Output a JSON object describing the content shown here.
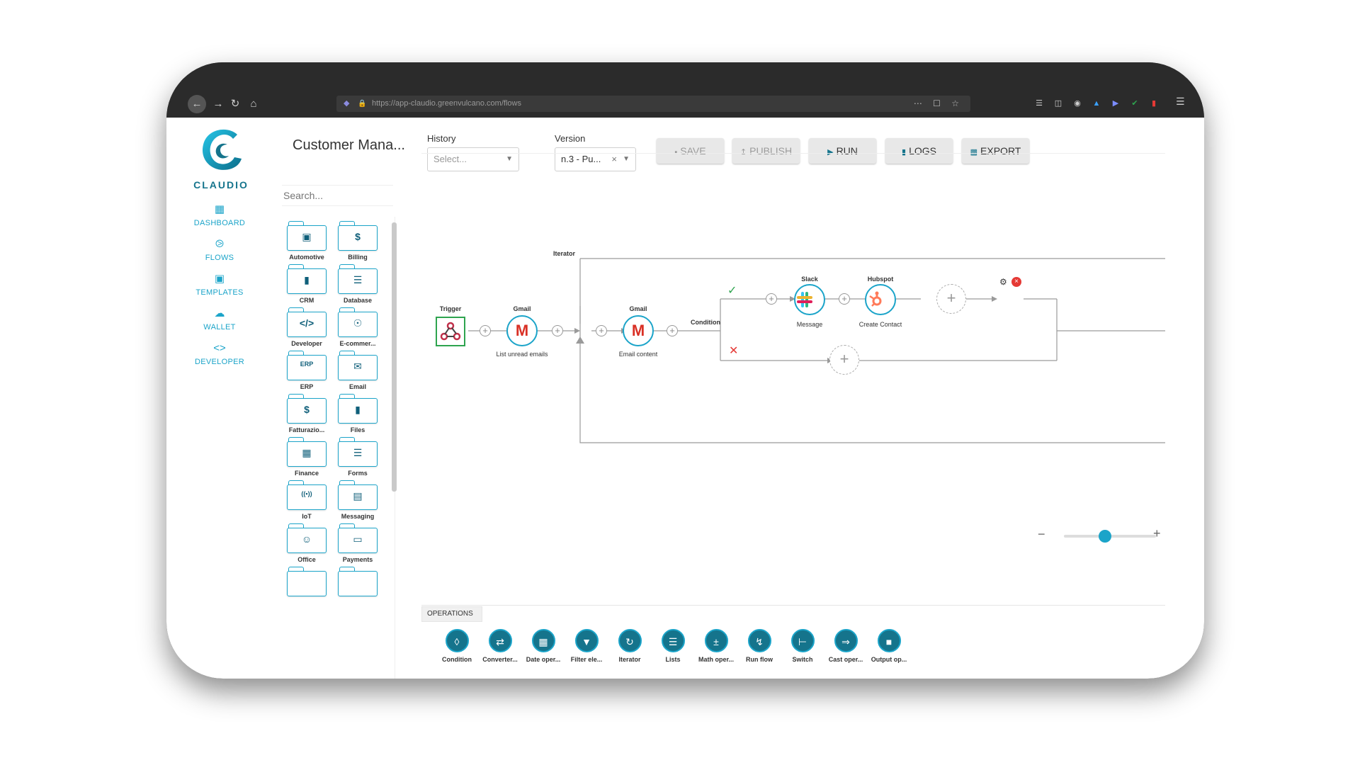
{
  "browser": {
    "url": "https://app-claudio.greenvulcano.com/flows",
    "nav": [
      "arrow-left-icon",
      "arrow-right-icon",
      "reload-icon",
      "home-icon"
    ]
  },
  "app": {
    "logo_text": "CLAUDIO",
    "nav": [
      {
        "label": "DASHBOARD",
        "icon": "dashboard-icon"
      },
      {
        "label": "FLOWS",
        "icon": "flows-icon"
      },
      {
        "label": "TEMPLATES",
        "icon": "templates-icon"
      },
      {
        "label": "WALLET",
        "icon": "cloud-icon"
      },
      {
        "label": "DEVELOPER",
        "icon": "code-icon"
      }
    ]
  },
  "header": {
    "title": "Customer Mana...",
    "history_label": "History",
    "history_placeholder": "Select...",
    "version_label": "Version",
    "version_value": "n.3 - Pu...",
    "buttons": {
      "save": "SAVE",
      "publish": "PUBLISH",
      "run": "RUN",
      "logs": "LOGS",
      "export": "EXPORT"
    }
  },
  "search": {
    "placeholder": "Search..."
  },
  "categories": [
    {
      "label": "Automotive",
      "icon": "car-icon"
    },
    {
      "label": "Billing",
      "icon": "billing-icon"
    },
    {
      "label": "CRM",
      "icon": "crm-icon"
    },
    {
      "label": "Database",
      "icon": "database-icon"
    },
    {
      "label": "Developer",
      "icon": "code-icon"
    },
    {
      "label": "E-commer...",
      "icon": "cart-icon"
    },
    {
      "label": "ERP",
      "icon": "erp-icon"
    },
    {
      "label": "Email",
      "icon": "mail-icon"
    },
    {
      "label": "Fatturazio...",
      "icon": "invoice-icon"
    },
    {
      "label": "Files",
      "icon": "file-icon"
    },
    {
      "label": "Finance",
      "icon": "finance-icon"
    },
    {
      "label": "Forms",
      "icon": "form-icon"
    },
    {
      "label": "IoT",
      "icon": "iot-icon"
    },
    {
      "label": "Messaging",
      "icon": "message-icon"
    },
    {
      "label": "Office",
      "icon": "office-icon"
    },
    {
      "label": "Payments",
      "icon": "payment-icon"
    }
  ],
  "flow": {
    "iterator_label": "Iterator",
    "trigger": {
      "title": "Trigger"
    },
    "gmail1": {
      "title": "Gmail",
      "label": "List unread emails"
    },
    "gmail2": {
      "title": "Gmail",
      "label": "Email content"
    },
    "condition_label": "Condition",
    "slack": {
      "title": "Slack",
      "label": "Message"
    },
    "hubspot": {
      "title": "Hubspot",
      "label": "Create Contact"
    }
  },
  "operations": {
    "tab_label": "OPERATIONS",
    "items": [
      {
        "label": "Condition",
        "icon": "condition-icon"
      },
      {
        "label": "Converter...",
        "icon": "converter-icon"
      },
      {
        "label": "Date oper...",
        "icon": "calendar-icon"
      },
      {
        "label": "Filter ele...",
        "icon": "filter-icon"
      },
      {
        "label": "Iterator",
        "icon": "iterator-icon"
      },
      {
        "label": "Lists",
        "icon": "list-icon"
      },
      {
        "label": "Math oper...",
        "icon": "math-icon"
      },
      {
        "label": "Run flow",
        "icon": "run-flow-icon"
      },
      {
        "label": "Switch",
        "icon": "switch-icon"
      },
      {
        "label": "Cast oper...",
        "icon": "cast-icon"
      },
      {
        "label": "Output op...",
        "icon": "output-icon"
      }
    ]
  },
  "colors": {
    "accent": "#1ba4c9",
    "brand_dark": "#15748c",
    "success": "#2ea44f",
    "danger": "#e53935"
  }
}
